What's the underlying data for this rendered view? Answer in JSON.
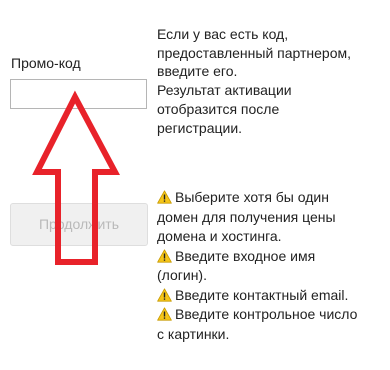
{
  "promo": {
    "label": "Промо-код",
    "value": "",
    "placeholder": ""
  },
  "info": {
    "lines": [
      "Если у вас есть код,",
      "предоставленный партнером,",
      "введите его.",
      "Результат активации",
      "отобразится после",
      "регистрации."
    ]
  },
  "continue_button": {
    "label": "Продолжить",
    "enabled": false
  },
  "warnings": {
    "icon": "warning-icon",
    "items": [
      {
        "lines": [
          "Выберите хотя бы один",
          "домен для получения цены",
          "домена и хостинга."
        ]
      },
      {
        "lines": [
          "Введите входное имя",
          "(логин)."
        ]
      },
      {
        "lines": [
          "Введите контактный email."
        ]
      },
      {
        "lines": [
          "Введите контрольное число",
          "с картинки."
        ]
      }
    ]
  },
  "annotation": {
    "shape": "up-arrow-outline",
    "color": "#e8222a"
  },
  "colors": {
    "warning_icon_fill": "#f5c518",
    "button_disabled_bg": "#f0f0f0",
    "button_disabled_text": "#b9b9b9",
    "input_border": "#b5b5b5"
  }
}
